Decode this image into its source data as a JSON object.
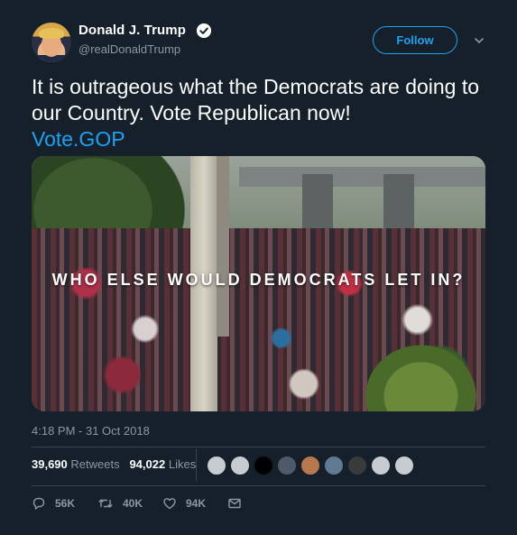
{
  "author": {
    "display_name": "Donald J. Trump",
    "handle": "@realDonaldTrump",
    "verified": true
  },
  "header": {
    "follow_label": "Follow"
  },
  "tweet": {
    "text": "It is outrageous what the Democrats are doing to our Country. Vote Republican now!",
    "link": "Vote.GOP",
    "media_caption": "WHO ELSE WOULD DEMOCRATS LET IN?",
    "timestamp": "4:18 PM - 31 Oct 2018"
  },
  "stats": {
    "retweets_count": "39,690",
    "retweets_label": "Retweets",
    "likes_count": "94,022",
    "likes_label": "Likes"
  },
  "actions": {
    "reply_count": "56K",
    "retweet_count": "40K",
    "like_count": "94K"
  },
  "colors": {
    "background": "#15202b",
    "accent": "#1da1f2",
    "muted_text": "#8899a6",
    "divider": "#38444d"
  },
  "icons": [
    "verified-badge-icon",
    "chevron-down-icon",
    "reply-icon",
    "retweet-icon",
    "heart-icon",
    "message-icon"
  ]
}
